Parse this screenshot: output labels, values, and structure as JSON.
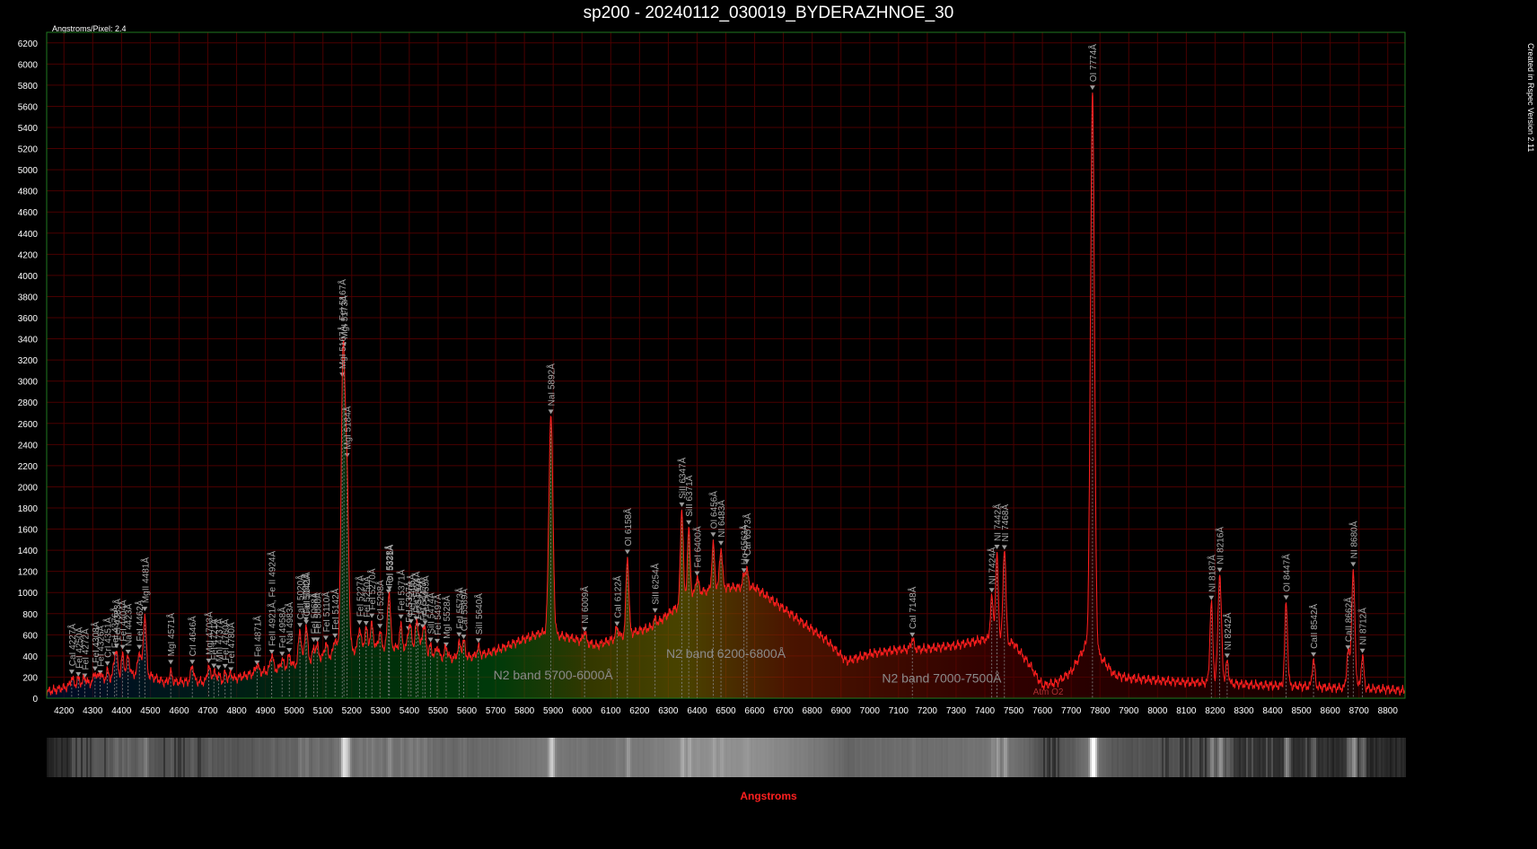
{
  "header": {
    "title": "sp200 - 20240112_030019_BYDERAZHNOE_30",
    "angstroms_per_pixel": "Angstroms/Pixel: 2.4",
    "created_note": "Created in Rspec Version 2.11"
  },
  "colors": {
    "background": "#000000",
    "plot_border": "#1f7a1f",
    "grid": "#4a0000",
    "curve": "#ff1e1e",
    "axis_text": "#ffffff",
    "xlabel": "#ff2020",
    "line_label": "#aaaaaa",
    "band_label": "#8a8a8a"
  },
  "chart_data": {
    "type": "line",
    "title": "sp200 - 20240112_030019_BYDERAZHNOE_30",
    "xlabel": "Angstroms",
    "ylabel": "",
    "xlim": [
      4140,
      8860
    ],
    "ylim": [
      0,
      6300
    ],
    "xticks": [
      4200,
      4300,
      4400,
      4500,
      4600,
      4700,
      4800,
      4900,
      5000,
      5100,
      5200,
      5300,
      5400,
      5500,
      5600,
      5700,
      5800,
      5900,
      6000,
      6100,
      6200,
      6300,
      6400,
      6500,
      6600,
      6700,
      6800,
      6900,
      7000,
      7100,
      7200,
      7300,
      7400,
      7500,
      7600,
      7700,
      7800,
      7900,
      8000,
      8100,
      8200,
      8300,
      8400,
      8500,
      8600,
      8700,
      8800
    ],
    "yticks": [
      0,
      200,
      400,
      600,
      800,
      1000,
      1200,
      1400,
      1600,
      1800,
      2000,
      2200,
      2400,
      2600,
      2800,
      3000,
      3200,
      3400,
      3600,
      3800,
      4000,
      4200,
      4400,
      4600,
      4800,
      5000,
      5200,
      5400,
      5600,
      5800,
      6000,
      6200
    ],
    "grid": true,
    "continuum": [
      [
        4140,
        60
      ],
      [
        4200,
        100
      ],
      [
        4300,
        150
      ],
      [
        4400,
        200
      ],
      [
        4470,
        250
      ],
      [
        4550,
        150
      ],
      [
        4650,
        160
      ],
      [
        4750,
        150
      ],
      [
        4850,
        230
      ],
      [
        4950,
        280
      ],
      [
        5050,
        350
      ],
      [
        5150,
        420
      ],
      [
        5250,
        480
      ],
      [
        5350,
        480
      ],
      [
        5450,
        400
      ],
      [
        5550,
        380
      ],
      [
        5640,
        400
      ],
      [
        5700,
        450
      ],
      [
        5800,
        560
      ],
      [
        5860,
        620
      ],
      [
        5950,
        580
      ],
      [
        6050,
        500
      ],
      [
        6150,
        600
      ],
      [
        6250,
        680
      ],
      [
        6300,
        800
      ],
      [
        6400,
        1000
      ],
      [
        6500,
        1050
      ],
      [
        6600,
        1050
      ],
      [
        6650,
        950
      ],
      [
        6750,
        750
      ],
      [
        6850,
        550
      ],
      [
        6920,
        350
      ],
      [
        7000,
        420
      ],
      [
        7100,
        460
      ],
      [
        7200,
        470
      ],
      [
        7300,
        500
      ],
      [
        7400,
        560
      ],
      [
        7500,
        520
      ],
      [
        7560,
        300
      ],
      [
        7600,
        120
      ],
      [
        7650,
        150
      ],
      [
        7700,
        250
      ],
      [
        7750,
        500
      ],
      [
        7800,
        400
      ],
      [
        7850,
        220
      ],
      [
        7900,
        190
      ],
      [
        7950,
        180
      ],
      [
        8000,
        170
      ],
      [
        8100,
        150
      ],
      [
        8200,
        150
      ],
      [
        8300,
        130
      ],
      [
        8400,
        120
      ],
      [
        8500,
        115
      ],
      [
        8600,
        100
      ],
      [
        8700,
        95
      ],
      [
        8800,
        85
      ],
      [
        8860,
        70
      ]
    ],
    "lines": [
      {
        "label": "CaI 4227Å",
        "x": 4227,
        "peak": 80
      },
      {
        "label": "FeI 4250Å",
        "x": 4250,
        "peak": 60
      },
      {
        "label": "FeI 4272Å",
        "x": 4272,
        "peak": 60
      },
      {
        "label": "FeI 4308Å",
        "x": 4308,
        "peak": 90
      },
      {
        "label": "FeI 4326Å",
        "x": 4326,
        "peak": 80
      },
      {
        "label": "CrI 4351Å",
        "x": 4351,
        "peak": 80
      },
      {
        "label": "FeI 4376Å",
        "x": 4376,
        "peak": 150
      },
      {
        "label": "FeI 4383Å",
        "x": 4383,
        "peak": 180
      },
      {
        "label": "FeI 4404Å",
        "x": 4404,
        "peak": 200
      },
      {
        "label": "NaI 4423Å",
        "x": 4423,
        "peak": 180
      },
      {
        "label": "FeI 4462Å",
        "x": 4462,
        "peak": 200
      },
      {
        "label": "MgII 4481Å",
        "x": 4481,
        "peak": 550
      },
      {
        "label": "MgI 4571Å",
        "x": 4571,
        "peak": 90
      },
      {
        "label": "CrI 4646Å",
        "x": 4646,
        "peak": 150
      },
      {
        "label": "MgI 4703Å",
        "x": 4703,
        "peak": 150
      },
      {
        "label": "FeI 4721Å",
        "x": 4721,
        "peak": 100
      },
      {
        "label": "MnI 4737Å",
        "x": 4737,
        "peak": 80
      },
      {
        "label": "FeI 4760Å",
        "x": 4760,
        "peak": 80
      },
      {
        "label": "FeI 4780Å",
        "x": 4780,
        "peak": 60
      },
      {
        "label": "FeI 4871Å",
        "x": 4871,
        "peak": 80
      },
      {
        "label": "FeII 4921Å, Fe II 4924Å",
        "x": 4922,
        "peak": 150
      },
      {
        "label": "FeI 4958Å",
        "x": 4958,
        "peak": 80
      },
      {
        "label": "NaI 4983Å",
        "x": 4983,
        "peak": 100
      },
      {
        "label": "CaII 5020Å",
        "x": 5020,
        "peak": 320
      },
      {
        "label": "FeI 5041Å",
        "x": 5041,
        "peak": 200
      },
      {
        "label": "CaI 5042Å",
        "x": 5042,
        "peak": 150
      },
      {
        "label": "FeI 5068Å",
        "x": 5068,
        "peak": 100
      },
      {
        "label": "FeI 5080Å",
        "x": 5080,
        "peak": 120
      },
      {
        "label": "FeI 5110Å",
        "x": 5110,
        "peak": 130
      },
      {
        "label": "FeI 5142Å",
        "x": 5142,
        "peak": 150
      },
      {
        "label": "MgI 5167Å, FeI 5167Å",
        "x": 5167,
        "peak": 1500
      },
      {
        "label": "MgI 5173Å",
        "x": 5173,
        "peak": 1700
      },
      {
        "label": "MgI 5184Å",
        "x": 5184,
        "peak": 1450
      },
      {
        "label": "FeI 5227Å",
        "x": 5227,
        "peak": 200
      },
      {
        "label": "FeI 5250Å",
        "x": 5250,
        "peak": 180
      },
      {
        "label": "FeI 5270Å",
        "x": 5270,
        "peak": 220
      },
      {
        "label": "CrI 5298Å",
        "x": 5298,
        "peak": 150
      },
      {
        "label": "FeI 5328Å",
        "x": 5328,
        "peak": 300
      },
      {
        "label": "OI 5331Å",
        "x": 5331,
        "peak": 250
      },
      {
        "label": "FeI 5371Å",
        "x": 5371,
        "peak": 220
      },
      {
        "label": "FeI 5397Å",
        "x": 5397,
        "peak": 180
      },
      {
        "label": "FeI 5406Å",
        "x": 5406,
        "peak": 180
      },
      {
        "label": "FeI 5424Å",
        "x": 5424,
        "peak": 200
      },
      {
        "label": "FeI 5430Å",
        "x": 5430,
        "peak": 180
      },
      {
        "label": "FeI 5447Å",
        "x": 5447,
        "peak": 200
      },
      {
        "label": "FeI 5455Å",
        "x": 5455,
        "peak": 180
      },
      {
        "label": "SiII 5474Å",
        "x": 5474,
        "peak": 100
      },
      {
        "label": "FeI 5497Å",
        "x": 5497,
        "peak": 100
      },
      {
        "label": "MgI 5528Å",
        "x": 5528,
        "peak": 100
      },
      {
        "label": "FeI 5573Å",
        "x": 5573,
        "peak": 130
      },
      {
        "label": "CaI 5589Å",
        "x": 5589,
        "peak": 150
      },
      {
        "label": "SiII 5640Å",
        "x": 5640,
        "peak": 80
      },
      {
        "label": "NaI 5892Å",
        "x": 5892,
        "peak": 2080
      },
      {
        "label": "NI 6009Å",
        "x": 6009,
        "peak": 100
      },
      {
        "label": "CaI 6122Å",
        "x": 6122,
        "peak": 100
      },
      {
        "label": "OI 6158Å",
        "x": 6158,
        "peak": 730
      },
      {
        "label": "SiII 6254Å",
        "x": 6254,
        "peak": 60
      },
      {
        "label": "SiII 6347Å",
        "x": 6347,
        "peak": 900
      },
      {
        "label": "SiII 6371Å",
        "x": 6371,
        "peak": 650
      },
      {
        "label": "FeI 6400Å",
        "x": 6400,
        "peak": 150
      },
      {
        "label": "OI 6456Å",
        "x": 6456,
        "peak": 420
      },
      {
        "label": "NI 6483Å",
        "x": 6483,
        "peak": 380
      },
      {
        "label": "Hα 6563Å",
        "x": 6563,
        "peak": 100
      },
      {
        "label": "CaI 6573Å",
        "x": 6573,
        "peak": 150
      },
      {
        "label": "CaI 7148Å",
        "x": 7148,
        "peak": 100
      },
      {
        "label": "NI 7424Å",
        "x": 7424,
        "peak": 400
      },
      {
        "label": "NI 7442Å",
        "x": 7442,
        "peak": 800
      },
      {
        "label": "NI 7468Å",
        "x": 7468,
        "peak": 900
      },
      {
        "label": "OI 7774Å",
        "x": 7774,
        "peak": 5300
      },
      {
        "label": "NI 8187Å",
        "x": 8187,
        "peak": 750
      },
      {
        "label": "NI 8216Å",
        "x": 8216,
        "peak": 1030
      },
      {
        "label": "NI 8242Å",
        "x": 8242,
        "peak": 200
      },
      {
        "label": "OI 8447Å",
        "x": 8447,
        "peak": 780
      },
      {
        "label": "CaII 8542Å",
        "x": 8542,
        "peak": 250
      },
      {
        "label": "CaII 8662Å",
        "x": 8662,
        "peak": 340
      },
      {
        "label": "NI 8680Å",
        "x": 8680,
        "peak": 1080
      },
      {
        "label": "NI 8712Å",
        "x": 8712,
        "peak": 300
      }
    ],
    "bands": [
      {
        "label": "N2 band 5700-6000Å",
        "x": 5900,
        "y": 180
      },
      {
        "label": "N2 band 6200-6800Å",
        "x": 6500,
        "y": 380
      },
      {
        "label": "N2 band 7000-7500Å",
        "x": 7250,
        "y": 150
      }
    ],
    "extra_labels": [
      {
        "label": "Atm O2",
        "x": 7620,
        "y": 35
      }
    ]
  }
}
